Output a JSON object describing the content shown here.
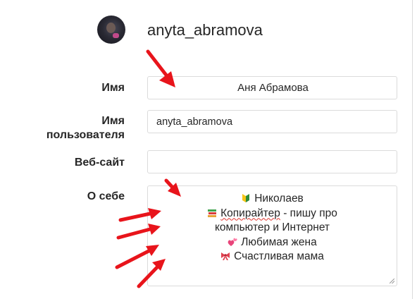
{
  "profile": {
    "username_heading": "anyta_abramova"
  },
  "form": {
    "name_label": "Имя",
    "name_value": "Аня Абрамова",
    "username_label_line1": "Имя",
    "username_label_line2": "пользователя",
    "username_value": "anyta_abramova",
    "website_label": "Веб-сайт",
    "website_value": "",
    "bio_label": "О себе",
    "bio_lines": [
      {
        "emoji": "beginner-badge-icon",
        "text": "Николаев"
      },
      {
        "emoji": "books-icon",
        "text_underlined": "Копирайтер",
        "text": " - пишу про"
      },
      {
        "emoji": "",
        "text": "компьютер и Интернет"
      },
      {
        "emoji": "two-hearts-icon",
        "text": "Любимая жена"
      },
      {
        "emoji": "ribbon-icon",
        "text": "Счастливая мама"
      }
    ]
  },
  "colors": {
    "arrow": "#e8141b",
    "border": "#dbdbdb",
    "text": "#262626"
  }
}
